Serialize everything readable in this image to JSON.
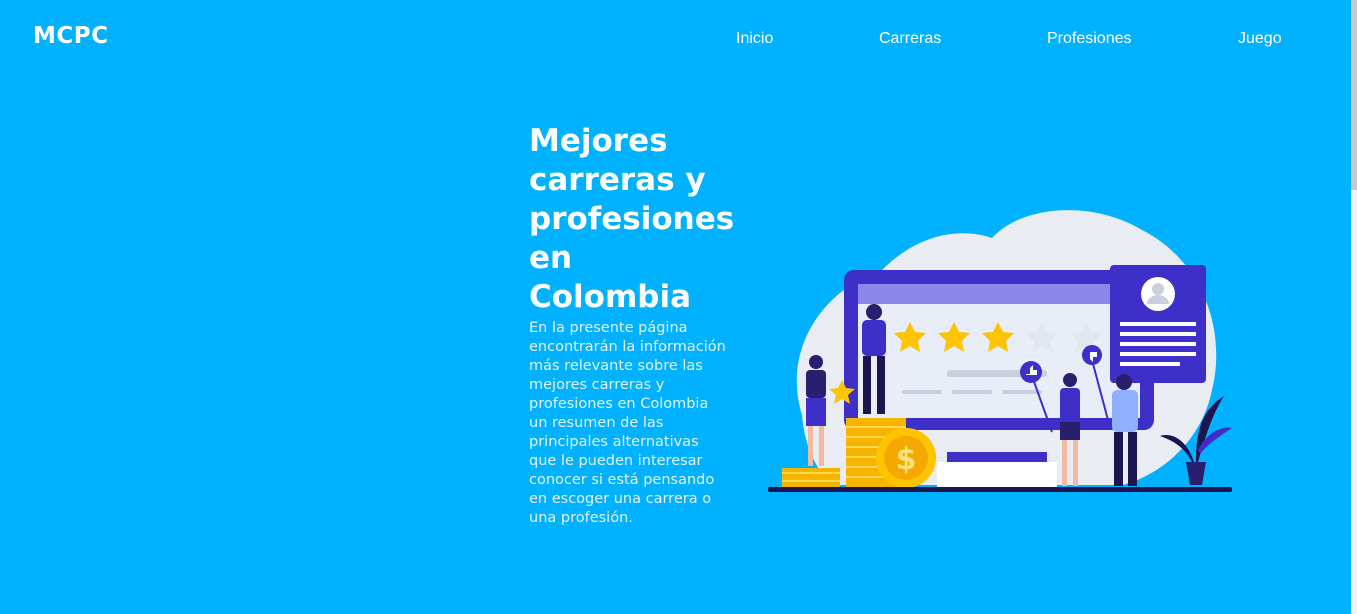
{
  "header": {
    "logo": "MCPC",
    "nav": [
      {
        "label": "Inicio"
      },
      {
        "label": "Carreras"
      },
      {
        "label": "Profesiones"
      },
      {
        "label": "Juego"
      }
    ]
  },
  "hero": {
    "title": "Mejores carreras y profesiones en Colombia",
    "description": "En la presente página encontrarán la información más relevante sobre las mejores carreras y profesiones en Colombia un resumen de las principales alternativas que le pueden interesar conocer si está pensando en escoger una carrera o una profesión."
  },
  "colors": {
    "background": "#00b1ff",
    "text": "#ffffff",
    "accent_purple": "#3d2fc7",
    "star_gold": "#ffc400"
  },
  "illustration": {
    "icon": "career-rating-illustration",
    "rating": {
      "filled": 3,
      "total": 5
    }
  }
}
